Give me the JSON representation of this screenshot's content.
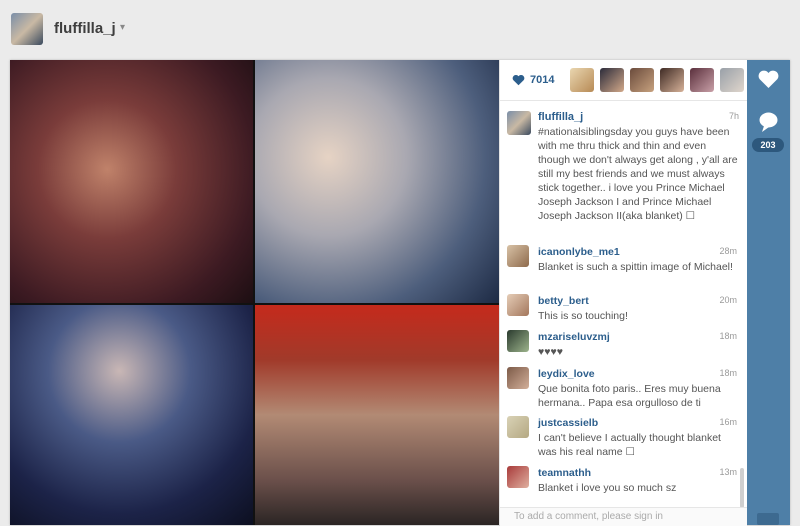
{
  "header": {
    "username": "fluffilla_j",
    "caret_icon": "chevron-down-icon"
  },
  "post": {
    "likes_count": "7014",
    "likers": [
      "liker-1",
      "liker-2",
      "liker-3",
      "liker-4",
      "liker-5",
      "liker-6"
    ],
    "caption": {
      "username": "fluffilla_j",
      "time": "7h",
      "text": "#nationalsiblingsday you guys have been with me thru thick and thin and even though we don't always get along , y'all are still my best friends and we must always stick together.. i love you Prince Michael Joseph Jackson I and Prince Michael Joseph Jackson II(aka blanket) ☐"
    },
    "comments": [
      {
        "username": "icanonlybe_me1",
        "time": "28m",
        "text": "Blanket is such a spittin image of Michael!"
      },
      {
        "username": "betty_bert",
        "time": "20m",
        "text": "This is so touching!"
      },
      {
        "username": "mzariseluvzmj",
        "time": "18m",
        "text": "♥♥♥♥"
      },
      {
        "username": "leydix_love",
        "time": "18m",
        "text": "Que bonita foto paris.. Eres muy buena hermana.. Papa esa orgulloso de ti"
      },
      {
        "username": "justcassielb",
        "time": "16m",
        "text": "I can't believe I actually thought blanket was his real name ☐"
      },
      {
        "username": "teamnathh",
        "time": "13m",
        "text": "Blanket i love you so much sz"
      }
    ],
    "comment_placeholder": "To add a comment, please sign in",
    "comments_count": "203"
  }
}
